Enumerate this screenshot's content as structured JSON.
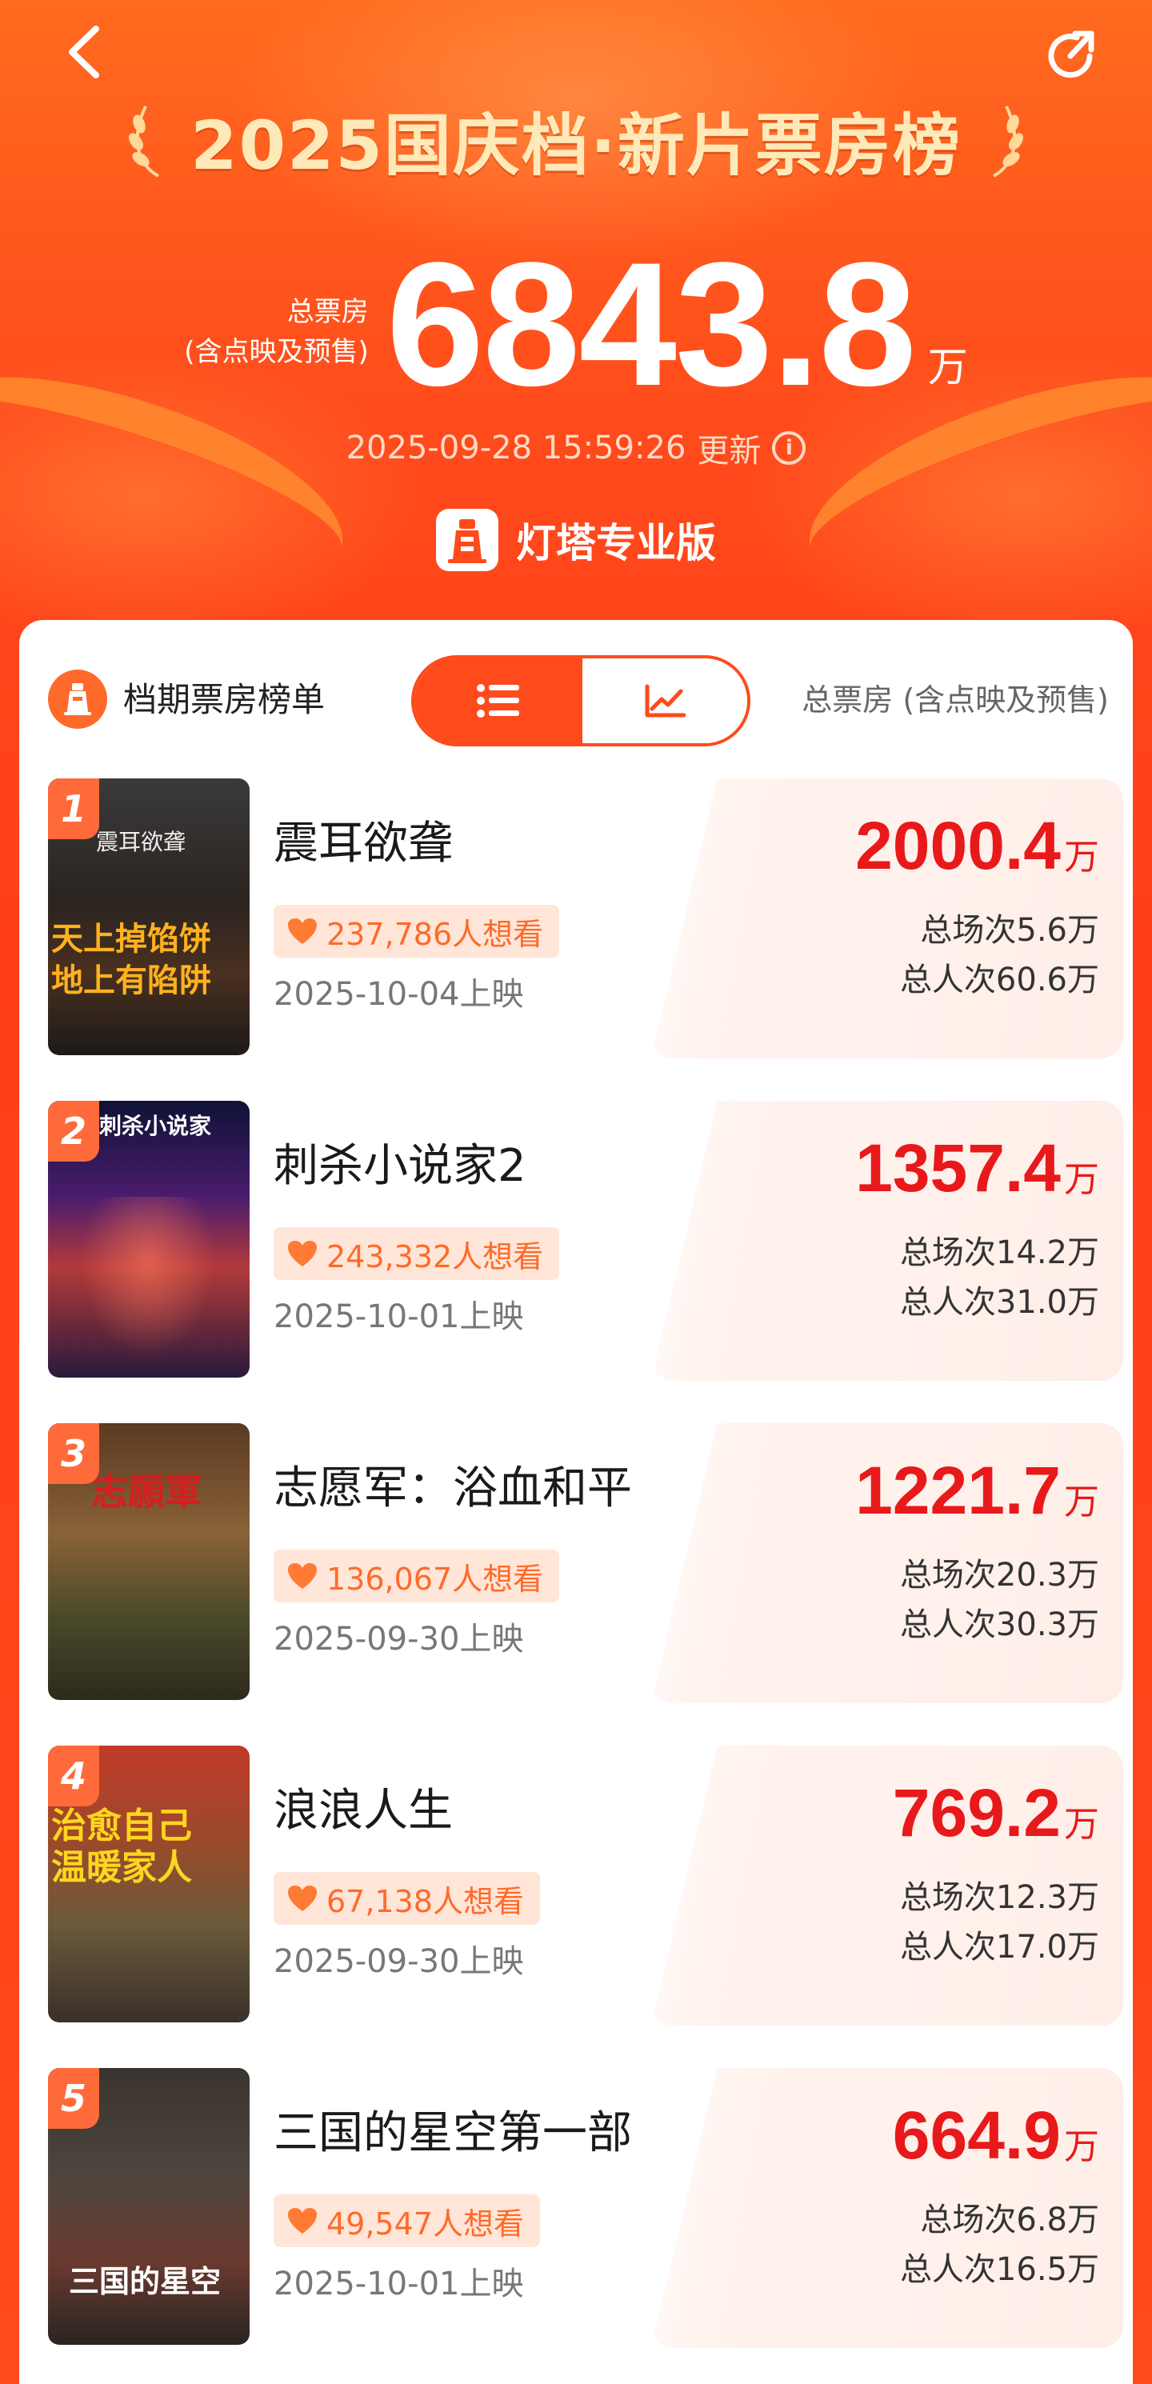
{
  "header": {
    "title": "2025国庆档·新片票房榜",
    "total_label_line1": "总票房",
    "total_label_line2": "(含点映及预售)",
    "total_value": "6843.8",
    "total_unit": "万",
    "update_time": "2025-09-28 15:59:26",
    "update_suffix": "更新",
    "brand": "灯塔专业版"
  },
  "list": {
    "title": "档期票房榜单",
    "metric_label": "总票房 (含点映及预售)"
  },
  "movies": [
    {
      "rank": "1",
      "name": "震耳欲聋",
      "want": "237,786人想看",
      "release": "2025-10-04上映",
      "gross": "2000.4",
      "unit": "万",
      "shows": "总场次5.6万",
      "viewers": "总人次60.6万",
      "poster_caption_top": "震耳欲聋",
      "poster_caption_a": "天上掉馅饼",
      "poster_caption_b": "地上有陷阱"
    },
    {
      "rank": "2",
      "name": "刺杀小说家2",
      "want": "243,332人想看",
      "release": "2025-10-01上映",
      "gross": "1357.4",
      "unit": "万",
      "shows": "总场次14.2万",
      "viewers": "总人次31.0万",
      "poster_caption_top": "刺杀小说家"
    },
    {
      "rank": "3",
      "name": "志愿军：浴血和平",
      "want": "136,067人想看",
      "release": "2025-09-30上映",
      "gross": "1221.7",
      "unit": "万",
      "shows": "总场次20.3万",
      "viewers": "总人次30.3万",
      "poster_caption_top": "志願軍"
    },
    {
      "rank": "4",
      "name": "浪浪人生",
      "want": "67,138人想看",
      "release": "2025-09-30上映",
      "gross": "769.2",
      "unit": "万",
      "shows": "总场次12.3万",
      "viewers": "总人次17.0万",
      "poster_caption_a": "治愈自己",
      "poster_caption_b": "温暖家人"
    },
    {
      "rank": "5",
      "name": "三国的星空第一部",
      "want": "49,547人想看",
      "release": "2025-10-01上映",
      "gross": "664.9",
      "unit": "万",
      "shows": "总场次6.8万",
      "viewers": "总人次16.5万",
      "poster_caption_b": "三国的星空"
    }
  ],
  "colors": {
    "accent": "#ff4a1c",
    "gross_red": "#e8191a",
    "want_bg": "#ffe6d8",
    "title_gold": "#ffe9b8"
  },
  "icons": {
    "back": "chevron-left-icon",
    "share": "share-icon",
    "info": "info-icon",
    "list": "list-icon",
    "chart": "trend-chart-icon",
    "heart": "heart-icon"
  }
}
